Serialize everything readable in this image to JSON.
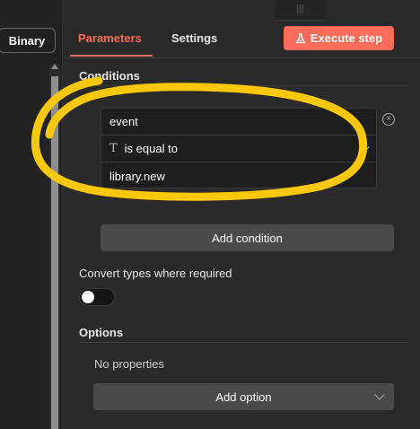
{
  "left_panel": {
    "binary_tab": "Binary"
  },
  "header": {
    "drag_handle": "|||",
    "tabs": [
      {
        "label": "Parameters",
        "active": true
      },
      {
        "label": "Settings",
        "active": false
      }
    ],
    "execute_button": "Execute step",
    "accent_color": "#ff6d5a"
  },
  "conditions": {
    "title": "Conditions",
    "rows": {
      "field": "event",
      "operator_icon": "T",
      "operator": "is equal to",
      "value": "library.new"
    },
    "add_button": "Add condition"
  },
  "convert_types": {
    "label": "Convert types where required",
    "enabled": false
  },
  "options": {
    "title": "Options",
    "empty_text": "No properties",
    "add_button": "Add option"
  },
  "annotation": {
    "color": "#ffc800",
    "shape": "hand-drawn-ellipse"
  }
}
